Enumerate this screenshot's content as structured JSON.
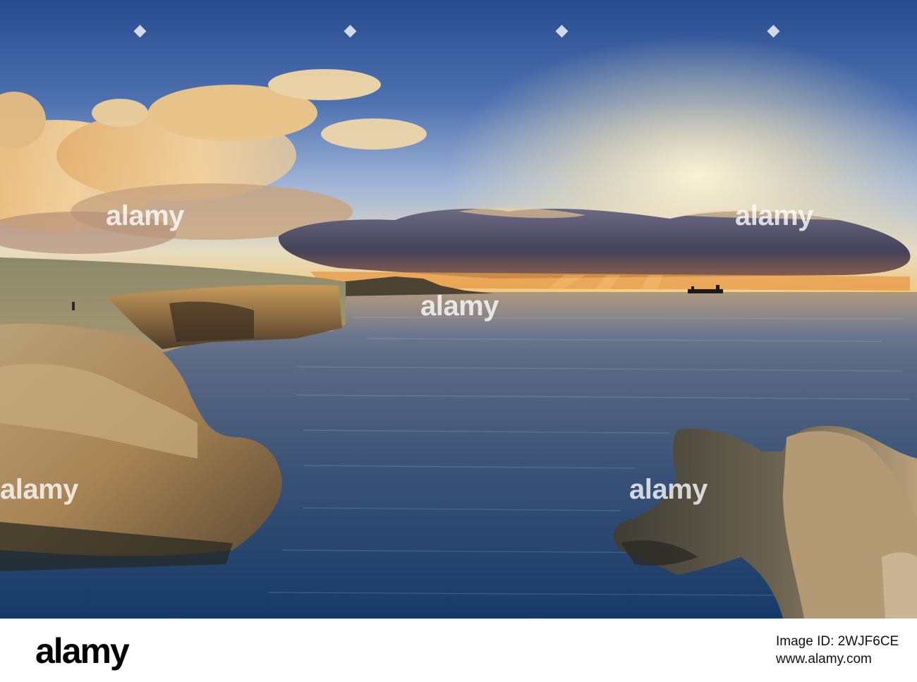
{
  "watermark": {
    "logo_text": "alamy",
    "image_id": "Image ID: 2WJF6CE",
    "site": "www.alamy.com"
  },
  "scene": {
    "colors": {
      "sky_top": "#2b4f93",
      "sky_mid": "#6f8fc4",
      "sky_horizon": "#f2e2b0",
      "sun_glow": "#ffe9a8",
      "cloud_bank": "#4b4a63",
      "cloud_lit": "#f1c27d",
      "sea_far": "#6d7890",
      "sea_near": "#1b3e6a",
      "rock_lit": "#c9a063",
      "rock_shadow": "#5b4a33"
    }
  }
}
